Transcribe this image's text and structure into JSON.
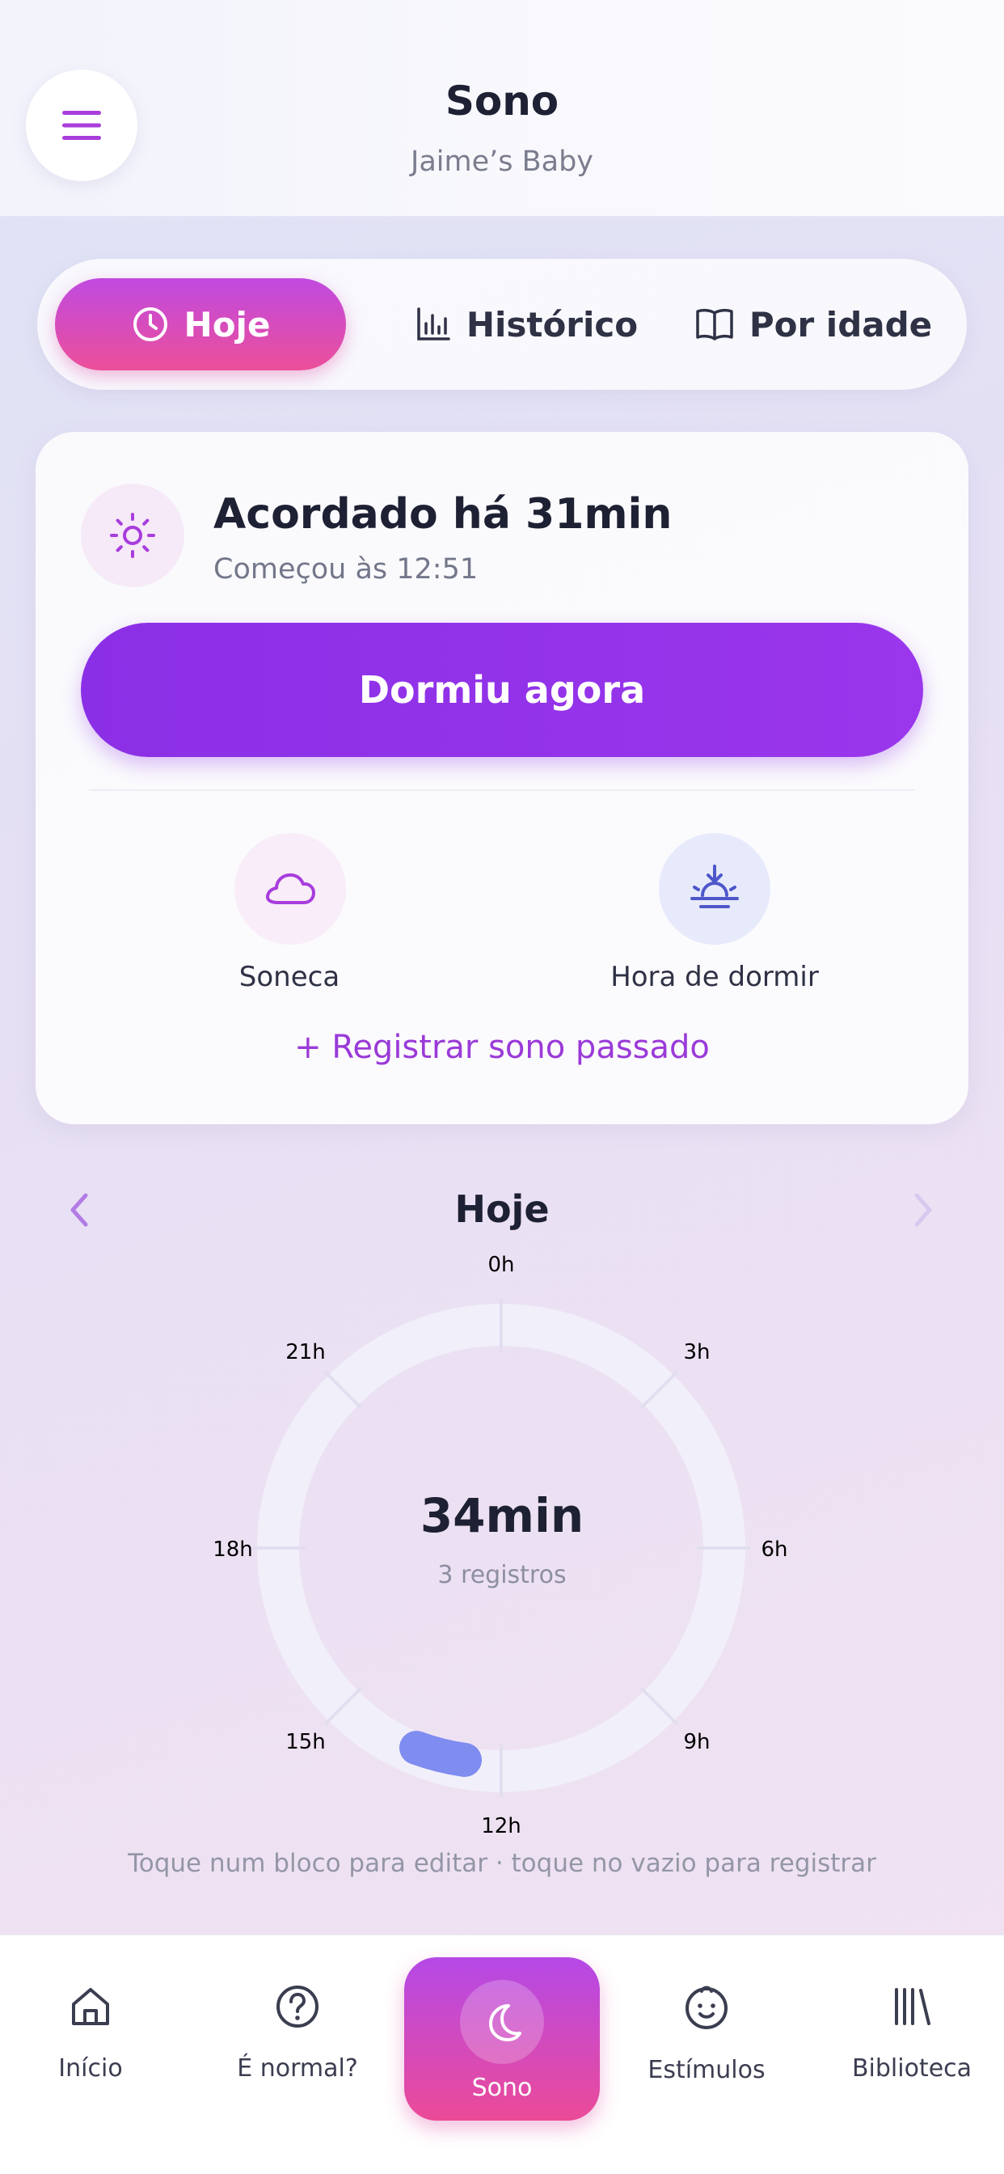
{
  "header": {
    "title": "Sono",
    "subtitle": "Jaime’s Baby",
    "menu_icon": "menu-icon"
  },
  "tabs": [
    {
      "label": "Hoje",
      "icon": "clock-icon",
      "active": true
    },
    {
      "label": "Histórico",
      "icon": "bar-chart-icon",
      "active": false
    },
    {
      "label": "Por idade",
      "icon": "book-icon",
      "active": false
    }
  ],
  "status": {
    "title": "Acordado há 31min",
    "subtitle": "Começou às 12:51",
    "icon": "sun-icon"
  },
  "primary_action": {
    "label": "Dormiu agora"
  },
  "quick_actions": [
    {
      "label": "Soneca",
      "icon": "cloud-icon"
    },
    {
      "label": "Hora de dormir",
      "icon": "sunset-icon"
    }
  ],
  "add_past": {
    "label": "+ Registrar sono passado"
  },
  "day": {
    "title": "Hoje",
    "ring_value": "34min",
    "ring_sub": "3 registros",
    "hint": "Toque num bloco para editar · toque no vazio para registrar",
    "ticks": {
      "t0": "0h",
      "t3": "3h",
      "t6": "6h",
      "t9": "9h",
      "t12": "12h",
      "t15": "15h",
      "t18": "18h",
      "t21": "21h"
    }
  },
  "colors": {
    "accent": "#9a36ec",
    "pink": "#ec4f9a",
    "sleep_block": "#7f8cf0"
  },
  "nav": [
    {
      "label": "Início",
      "icon": "home-icon",
      "active": false
    },
    {
      "label": "É normal?",
      "icon": "question-icon",
      "active": false
    },
    {
      "label": "Sono",
      "icon": "moon-icon",
      "active": true
    },
    {
      "label": "Estímulos",
      "icon": "baby-face-icon",
      "active": false
    },
    {
      "label": "Biblioteca",
      "icon": "library-icon",
      "active": false
    }
  ]
}
